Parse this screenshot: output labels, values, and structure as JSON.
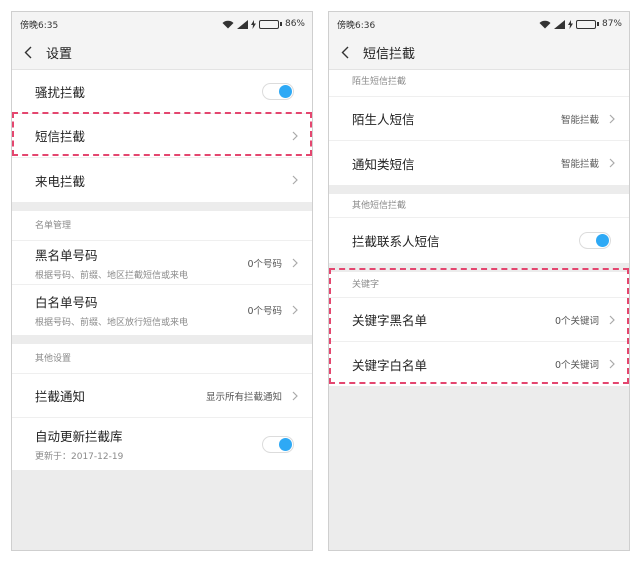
{
  "left": {
    "status": {
      "carrier_time": "傍晚6:35",
      "battery_pct": "86%",
      "battery_level": 0.86
    },
    "title": "设置",
    "rows": {
      "harass": {
        "label": "骚扰拦截",
        "toggle_on": true
      },
      "sms": {
        "label": "短信拦截"
      },
      "call": {
        "label": "来电拦截"
      }
    },
    "list_header": "名单管理",
    "blacklist": {
      "label": "黑名单号码",
      "sub": "根据号码、前缀、地区拦截短信或来电",
      "value": "0个号码"
    },
    "whitelist": {
      "label": "白名单号码",
      "sub": "根据号码、前缀、地区放行短信或来电",
      "value": "0个号码"
    },
    "other_header": "其他设置",
    "notify": {
      "label": "拦截通知",
      "value": "显示所有拦截通知"
    },
    "autoupdate": {
      "label": "自动更新拦截库",
      "sub": "更新于：2017-12-19",
      "toggle_on": true
    }
  },
  "right": {
    "status": {
      "carrier_time": "傍晚6:36",
      "battery_pct": "87%",
      "battery_level": 0.87
    },
    "title": "短信拦截",
    "stranger_header": "陌生短信拦截",
    "stranger_sms": {
      "label": "陌生人短信",
      "value": "智能拦截"
    },
    "notice_sms": {
      "label": "通知类短信",
      "value": "智能拦截"
    },
    "other_header": "其他短信拦截",
    "contact_sms": {
      "label": "拦截联系人短信",
      "toggle_on": true
    },
    "keyword_header": "关键字",
    "kw_black": {
      "label": "关键字黑名单",
      "value": "0个关键词"
    },
    "kw_white": {
      "label": "关键字白名单",
      "value": "0个关键词"
    }
  },
  "colors": {
    "accent": "#2ea9f5",
    "highlight": "#e4466f",
    "battery": "#4cc24a"
  }
}
